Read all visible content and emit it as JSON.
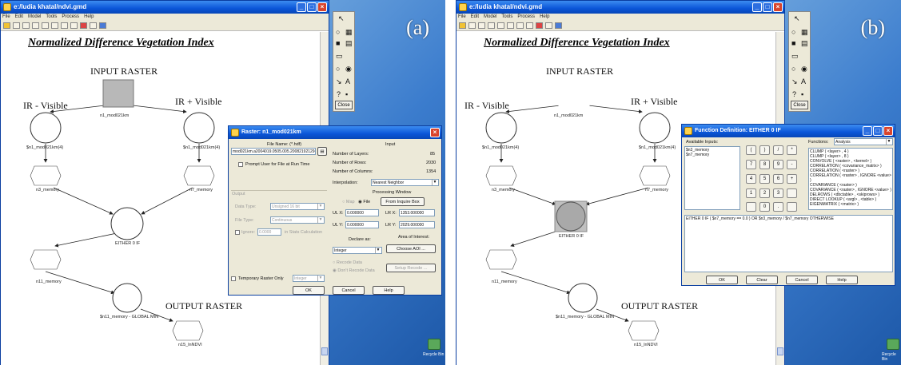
{
  "labels": {
    "a": "(a)",
    "b": "(b)"
  },
  "window": {
    "title": "e:/ludia khatal/ndvi.gmd",
    "menu": [
      "File",
      "Edit",
      "Model",
      "Tools",
      "Process",
      "Help"
    ]
  },
  "model": {
    "title": "Normalized Difference Vegetation Index",
    "input_raster": "INPUT RASTER",
    "ir_minus_visible": "IR - Visible",
    "ir_plus_visible": "IR + Visible",
    "raster_name": "n1_mod021km",
    "left_func": "$n1_mod021km(4)",
    "right_func": "$n1_mod021km(4)",
    "n3": "n3_memory",
    "n7": "n7_memory",
    "either": "EITHER 0 IF",
    "n11": "n11_memory",
    "global_min": "$n11_memory - GLOBAL MIN",
    "output_raster": "OUTPUT RASTER",
    "output_name": "n15_lnNDVI"
  },
  "toolpalette": {
    "close": "Close",
    "glyph_a": "A",
    "glyph_q": "?"
  },
  "recycle": "Recycle Bin",
  "raster_dialog": {
    "title": "Raster: n1_mod021km",
    "file_name_label": "File Name: (*.hdf)",
    "file_value": "mod021km.a2004019.0505.005.2008219212946.hdf",
    "prompt_label": "Prompt User for File at Run Time",
    "output_section": "Output",
    "data_type_label": "Data Type:",
    "data_type_value": "Unsigned 16 bit",
    "file_type_label": "File Type:",
    "file_type_value": "Continuous",
    "ignore_label": "Ignore:",
    "ignore_value": "0.0000",
    "in_stats": "in Stats Calculation",
    "input_header": "Input",
    "layers_label": "Number of Layers:",
    "layers_value": "85",
    "rows_label": "Number of Rows:",
    "rows_value": "2030",
    "cols_label": "Number of Columns:",
    "cols_value": "1354",
    "interp_label": "Interpolation:",
    "interp_value": "Nearest Neighbor",
    "proc_window": "Processing Window",
    "map_label": "Map",
    "file_label": "File",
    "from_inquire": "From Inquire Box",
    "ulx_label": "UL X:",
    "ulx_value": "0.000000",
    "lrx_label": "LR X:",
    "lrx_value": "1353.000000",
    "uly_label": "UL Y:",
    "uly_value": "0.000000",
    "lry_label": "LR Y:",
    "lry_value": "2029.000000",
    "declare_as": "Declare as:",
    "declare_value": "Integer",
    "aoi_label": "Area of Interest:",
    "choose_aoi": "Choose AOI ...",
    "recode_data": "Recode Data",
    "dont_recode": "Don't Recode Data",
    "setup_recode": "Setup Recode ...",
    "temp_raster": "Temporary Raster Only",
    "temp_type": "Integer",
    "ok": "OK",
    "cancel": "Cancel",
    "help": "Help"
  },
  "func_dialog": {
    "title": "Function Definition: EITHER 0 IF",
    "available_label": "Available Inputs:",
    "inputs": [
      "$n3_memory",
      "$n7_memory"
    ],
    "keys": [
      "'(' ",
      ")",
      "/",
      "*",
      "7",
      "8",
      "9",
      "-",
      "4",
      "5",
      "6",
      "+",
      "1",
      "2",
      "3",
      "",
      "",
      ".",
      "0"
    ],
    "functions_label": "Functions:",
    "functions_value": "Analysis",
    "functions": [
      "CLUMP ( <layer> , 4 )",
      "CLUMP ( <layer> , 8 )",
      "CONVOLVE ( <raster> , <kernel> )",
      "CORRELATION ( <covariance_matrix> )",
      "CORRELATION ( <raster> )",
      "CORRELATION ( <raster> , IGNORE <value> )",
      "COVARIANCE ( <raster> )",
      "COVARIANCE ( <raster> , IGNORE <value> )",
      "DELROWS ( <dbctable> , <skiprows> )",
      "DIRECT LOOKUP ( <argl> , <table> )",
      "EIGENMATRIX ( <matrix> )"
    ],
    "expression": "EITHER 0 IF ( $n7_memory == 0.0 ) OR $n3_memory / $n7_memory OTHERWISE",
    "ok": "OK",
    "clear": "Clear",
    "cancel": "Cancel",
    "help": "Help"
  }
}
